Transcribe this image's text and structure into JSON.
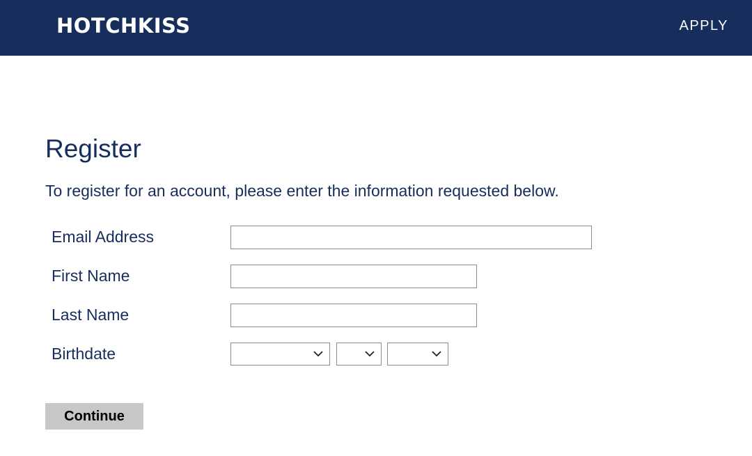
{
  "header": {
    "logo_text": "HOTCHKISS",
    "apply_label": "APPLY",
    "background_color": "#172d5c"
  },
  "main": {
    "title": "Register",
    "intro": "To register for an account, please enter the information requested below."
  },
  "form": {
    "email_label": "Email Address",
    "email_value": "",
    "first_name_label": "First Name",
    "first_name_value": "",
    "last_name_label": "Last Name",
    "last_name_value": "",
    "birthdate_label": "Birthdate",
    "birthdate_month_value": "",
    "birthdate_day_value": "",
    "birthdate_year_value": "",
    "select_icon": "chevron-down-icon",
    "continue_label": "Continue"
  }
}
